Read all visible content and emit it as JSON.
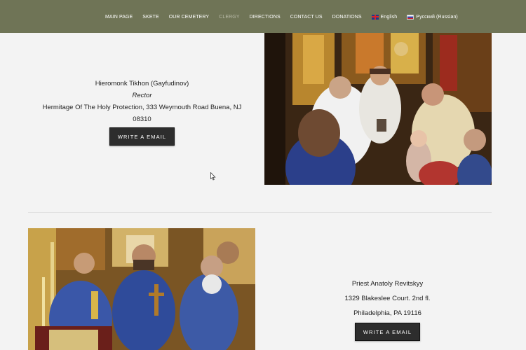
{
  "nav": {
    "items": [
      {
        "label": "MAIN PAGE",
        "active": false
      },
      {
        "label": "SKETE",
        "active": false
      },
      {
        "label": "OUR CEMETERY",
        "active": false
      },
      {
        "label": "CLERGY",
        "active": true
      },
      {
        "label": "DIRECTIONS",
        "active": false
      },
      {
        "label": "CONTACT US",
        "active": false
      },
      {
        "label": "DONATIONS",
        "active": false
      }
    ],
    "lang_en": "English",
    "lang_ru": "Русский (Russian)"
  },
  "clergy": [
    {
      "name": "Hieromonk Tikhon (Gayfudinov)",
      "role": "Rector",
      "address": "Hermitage Of The Holy Protection, 333 Weymouth Road Buena, NJ 08310",
      "button": "WRITE A EMAIL"
    },
    {
      "name": "Priest Anatoly Revitskyy",
      "address_line1": "1329 Blakeslee Court. 2nd fl.",
      "address_line2": "Philadelphia, PA 19116",
      "button": "WRITE A EMAIL"
    }
  ],
  "colors": {
    "navbar": "#6f7456",
    "active_nav": "#b9bba8",
    "button": "#2d2d2d"
  }
}
